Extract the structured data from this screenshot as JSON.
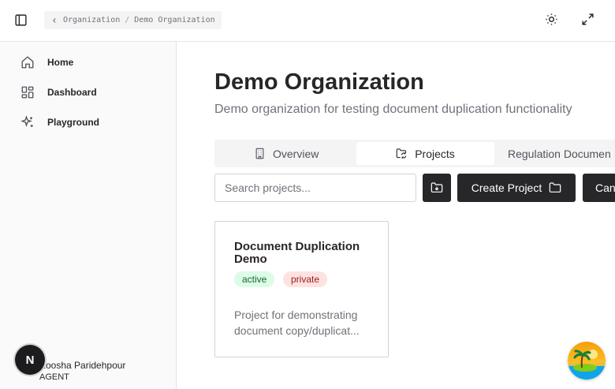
{
  "header": {
    "breadcrumb": [
      "Organization",
      "Demo Organization"
    ],
    "breadcrumb_separator": "/",
    "icons": [
      "sidebar-toggle-icon",
      "chevron-left-icon",
      "sun-icon",
      "expand-icon"
    ]
  },
  "sidebar": {
    "items": [
      {
        "label": "Home",
        "icon": "home-icon"
      },
      {
        "label": "Dashboard",
        "icon": "dashboard-icon"
      },
      {
        "label": "Playground",
        "icon": "sparkles-icon"
      }
    ],
    "user": {
      "initial": "N",
      "name": "Koosha Paridehpour",
      "role": "AGENT"
    }
  },
  "main": {
    "title": "Demo Organization",
    "subtitle": "Demo organization for testing document duplication functionality",
    "tabs": [
      {
        "label": "Overview",
        "icon": "building-icon",
        "active": false
      },
      {
        "label": "Projects",
        "icon": "folder-sync-icon",
        "active": true
      },
      {
        "label": "Regulation Documen",
        "icon": "",
        "active": false
      }
    ],
    "search": {
      "placeholder": "Search projects...",
      "value": ""
    },
    "buttons": {
      "import_icon": "folder-import-icon",
      "create_project": "Create Project",
      "create_project_icon": "folder-icon",
      "truncated": "Can"
    },
    "project_card": {
      "title": "Document Duplication Demo",
      "badges": [
        "active",
        "private"
      ],
      "description_lines": [
        "Project for demonstrating",
        "document copy/duplicat..."
      ]
    }
  },
  "colors": {
    "primary_dark": "#27272a",
    "muted_text": "#71717a",
    "border": "#e4e4e7",
    "badge_active_bg": "#dcfce7",
    "badge_private_bg": "#fee2e2"
  }
}
